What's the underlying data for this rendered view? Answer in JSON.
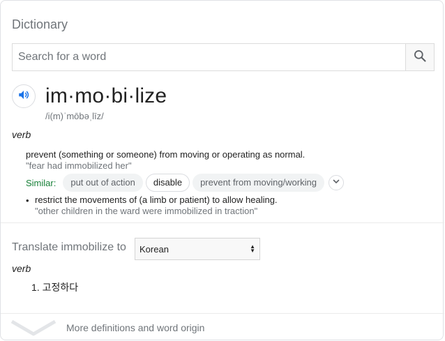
{
  "card": {
    "title": "Dictionary",
    "search": {
      "placeholder": "Search for a word",
      "value": "",
      "icon": "search-icon"
    },
    "entry": {
      "headword": "im·mo·bi·lize",
      "phonetic": "/i(m)ˈmōbəˌlīz/",
      "audio_icon": "speaker-icon",
      "part_of_speech": "verb",
      "senses": [
        {
          "definition": "prevent (something or someone) from moving or operating as normal.",
          "example": "\"fear had immobilized her\"",
          "similar_label": "Similar:",
          "similar": [
            "put out of action",
            "disable",
            "prevent from moving/working"
          ]
        },
        {
          "definition": "restrict the movements of (a limb or patient) to allow healing.",
          "example": "\"other children in the ward were immobilized in traction\""
        }
      ]
    },
    "translate": {
      "label": "Translate immobilize to",
      "language": "Korean",
      "part_of_speech": "verb",
      "items": [
        "1. 고정하다"
      ]
    },
    "more": {
      "label": "More definitions and word origin",
      "icon": "chevron-down-icon"
    }
  },
  "colors": {
    "similar_label": "#188038",
    "muted_text": "#70757a",
    "speaker_icon": "#1a73e8"
  }
}
